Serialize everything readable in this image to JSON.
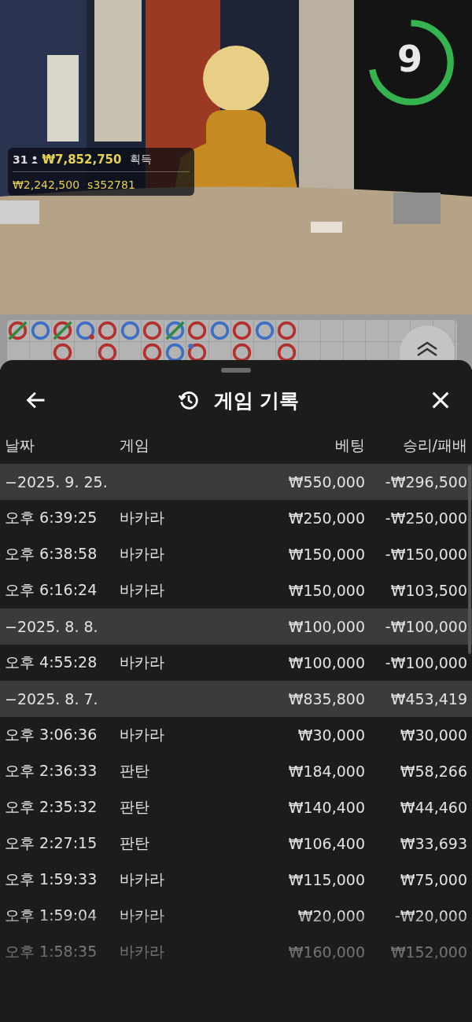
{
  "timer": {
    "value": "9",
    "level": 0.72
  },
  "stats": {
    "players": "31",
    "winnings": "₩7,852,750",
    "winnings_label": "획득",
    "total": "₩2,242,500",
    "bettor": "s352781"
  },
  "road": {
    "columns": [
      {
        "cells": [
          {
            "color": "#b5302c",
            "tie": true
          }
        ]
      },
      {
        "cells": [
          {
            "color": "#3d6fc4",
            "tie": false
          }
        ]
      },
      {
        "cells": [
          {
            "color": "#b5302c",
            "tie": true
          },
          {
            "color": "#b5302c",
            "tie": false
          }
        ]
      },
      {
        "cells": [
          {
            "color": "#3d6fc4",
            "tie": false,
            "dot": {
              "color": "#b5302c"
            }
          }
        ]
      },
      {
        "cells": [
          {
            "color": "#b5302c",
            "tie": false
          },
          {
            "color": "#b5302c",
            "tie": false
          }
        ]
      },
      {
        "cells": [
          {
            "color": "#3d6fc4",
            "tie": false
          }
        ]
      },
      {
        "cells": [
          {
            "color": "#b5302c",
            "tie": false
          },
          {
            "color": "#b5302c",
            "tie": false
          }
        ]
      },
      {
        "cells": [
          {
            "color": "#3d6fc4",
            "tie": true
          },
          {
            "color": "#3d6fc4",
            "tie": false
          }
        ]
      },
      {
        "cells": [
          {
            "color": "#b5302c",
            "tie": false
          },
          {
            "color": "#b5302c",
            "tie": false,
            "dot": {
              "color": "#3d6fc4"
            }
          }
        ]
      },
      {
        "cells": [
          {
            "color": "#3d6fc4",
            "tie": false
          }
        ]
      },
      {
        "cells": [
          {
            "color": "#b5302c",
            "tie": false
          },
          {
            "color": "#b5302c",
            "tie": false
          }
        ]
      },
      {
        "cells": [
          {
            "color": "#3d6fc4",
            "tie": false
          }
        ]
      },
      {
        "cells": [
          {
            "color": "#b5302c",
            "tie": false
          },
          {
            "color": "#b5302c",
            "tie": false
          }
        ]
      }
    ]
  },
  "sheet": {
    "title": "게임 기록",
    "columns": [
      "날짜",
      "게임",
      "베팅",
      "승리/패배"
    ],
    "rows": [
      {
        "kind": "group",
        "date": "−2025. 9. 25.",
        "bet": "₩550,000",
        "result": "-₩296,500"
      },
      {
        "kind": "entry",
        "time": "오후 6:39:25",
        "game": "바카라",
        "bet": "₩250,000",
        "result": "-₩250,000"
      },
      {
        "kind": "entry",
        "time": "오후 6:38:58",
        "game": "바카라",
        "bet": "₩150,000",
        "result": "-₩150,000"
      },
      {
        "kind": "entry",
        "time": "오후 6:16:24",
        "game": "바카라",
        "bet": "₩150,000",
        "result": "₩103,500"
      },
      {
        "kind": "group",
        "date": "−2025. 8. 8.",
        "bet": "₩100,000",
        "result": "-₩100,000"
      },
      {
        "kind": "entry",
        "time": "오후 4:55:28",
        "game": "바카라",
        "bet": "₩100,000",
        "result": "-₩100,000"
      },
      {
        "kind": "group",
        "date": "−2025. 8. 7.",
        "bet": "₩835,800",
        "result": "₩453,419"
      },
      {
        "kind": "entry",
        "time": "오후 3:06:36",
        "game": "바카라",
        "bet": "₩30,000",
        "result": "₩30,000"
      },
      {
        "kind": "entry",
        "time": "오후 2:36:33",
        "game": "판탄",
        "bet": "₩184,000",
        "result": "₩58,266"
      },
      {
        "kind": "entry",
        "time": "오후 2:35:32",
        "game": "판탄",
        "bet": "₩140,400",
        "result": "₩44,460"
      },
      {
        "kind": "entry",
        "time": "오후 2:27:15",
        "game": "판탄",
        "bet": "₩106,400",
        "result": "₩33,693"
      },
      {
        "kind": "entry",
        "time": "오후 1:59:33",
        "game": "바카라",
        "bet": "₩115,000",
        "result": "₩75,000"
      },
      {
        "kind": "entry",
        "time": "오후 1:59:04",
        "game": "바카라",
        "bet": "₩20,000",
        "result": "-₩20,000"
      },
      {
        "kind": "entry",
        "time": "오후 1:58:35",
        "game": "바카라",
        "bet": "₩160,000",
        "result": "₩152,000"
      }
    ]
  }
}
